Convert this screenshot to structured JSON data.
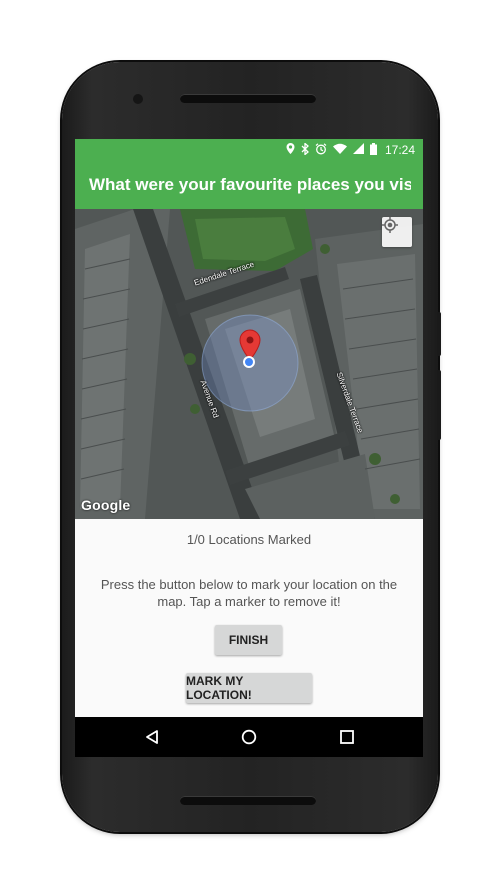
{
  "status_bar": {
    "time": "17:24",
    "icons": [
      "location-icon",
      "bluetooth-icon",
      "alarm-icon",
      "wifi-icon",
      "signal-icon",
      "battery-icon"
    ]
  },
  "app_bar": {
    "title": "What were your favourite places you vis..."
  },
  "map": {
    "streets": [
      "Edendale Terrace",
      "Avenue Rd",
      "Silverdale Terrace"
    ],
    "attribution": "Google",
    "my_location_button_icon": "my-location-icon"
  },
  "panel": {
    "counter": "1/0 Locations Marked",
    "instructions": "Press the button below to mark your location on the map. Tap a marker to remove it!",
    "finish_label": "FINISH",
    "mark_label": "MARK MY LOCATION!"
  },
  "nav": {
    "icons": [
      "back-icon",
      "home-icon",
      "recents-icon"
    ]
  },
  "colors": {
    "primary": "#4caf50",
    "marker": "#e53935",
    "location_dot": "#4285f4"
  }
}
